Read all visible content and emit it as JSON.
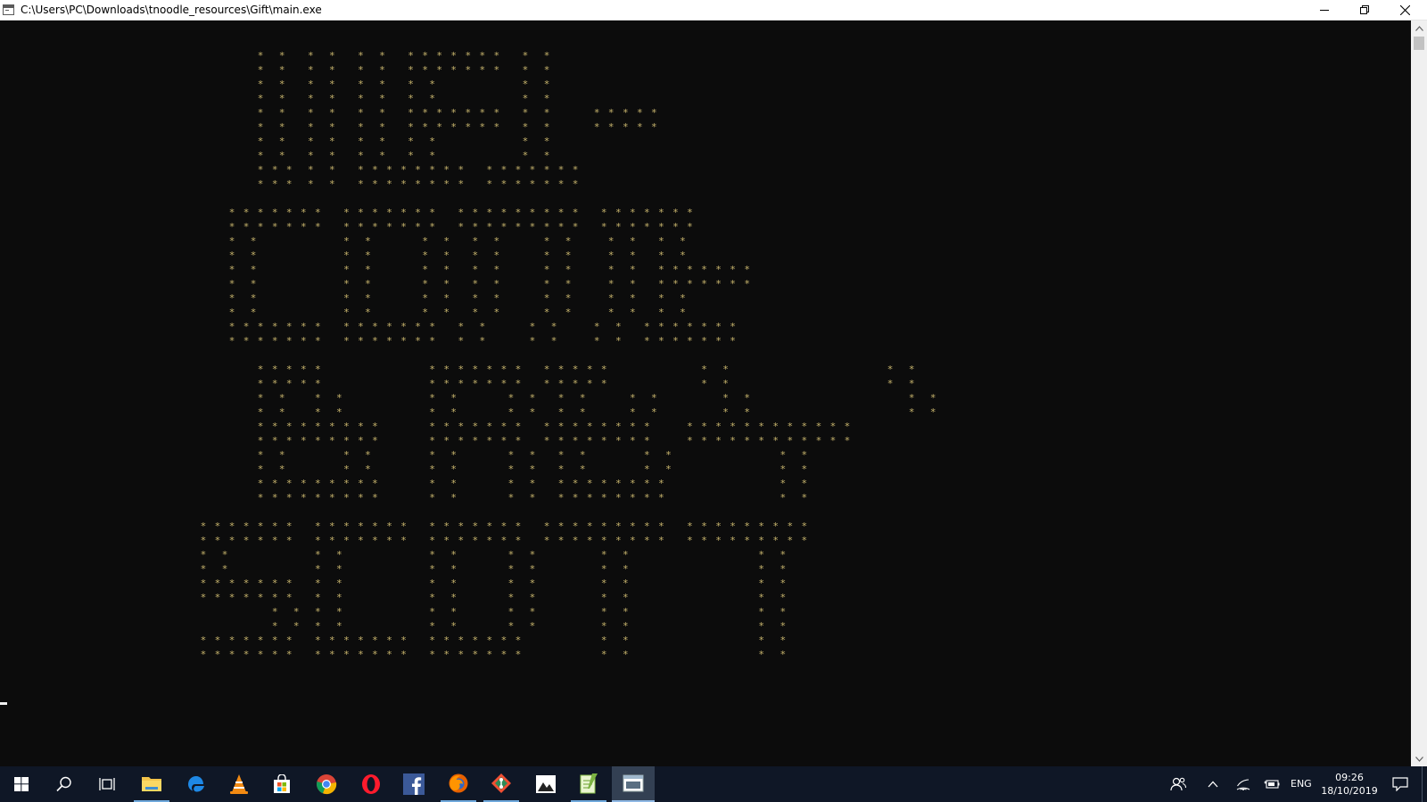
{
  "window": {
    "title": "C:\\Users\\PC\\Downloads\\tnoodle_resources\\Gift\\main.exe"
  },
  "console": {
    "banner_lines": [
      "                                ",
      "                                ",
      "                                    *  *   *  *   *  *   * * * * * * *   *  *",
      "                                    *  *   *  *   *  *   * * * * * * *   *  *",
      "                                    *  *   *  *   *  *   *  *            *  *",
      "                                    *  *   *  *   *  *   *  *            *  *",
      "                                    *  *   *  *   *  *   * * * * * * *   *  *      * * * * *",
      "                                    *  *   *  *   *  *   * * * * * * *   *  *      * * * * *",
      "                                    *  *   *  *   *  *   *  *            *  *",
      "                                    *  *   *  *   *  *   *  *            *  *",
      "                                    * * *  *  *   * * * * * * * *   * * * * * * *",
      "                                    * * *  *  *   * * * * * * * *   * * * * * * *",
      "                                ",
      "                                * * * * * * *   * * * * * * *   * * * * * * * * *   * * * * * * *",
      "                                * * * * * * *   * * * * * * *   * * * * * * * * *   * * * * * * *",
      "                                *  *            *  *       *  *   *  *      *  *     *  *   *  *",
      "                                *  *            *  *       *  *   *  *      *  *     *  *   *  *",
      "                                *  *            *  *       *  *   *  *      *  *     *  *   * * * * * * *",
      "                                *  *            *  *       *  *   *  *      *  *     *  *   * * * * * * *",
      "                                *  *            *  *       *  *   *  *      *  *     *  *   *  *",
      "                                *  *            *  *       *  *   *  *      *  *     *  *   *  *",
      "                                * * * * * * *   * * * * * * *   *  *      *  *     *  *   * * * * * * *",
      "                                * * * * * * *   * * * * * * *   *  *      *  *     *  *   * * * * * * *",
      "                                ",
      "                                    * * * * *               * * * * * * *   * * * * *             *  *                      *  *",
      "                                    * * * * *               * * * * * * *   * * * * *             *  *                      *  *",
      "                                    *  *    *  *            *  *       *  *   *  *      *  *         *  *                      *  *",
      "                                    *  *    *  *            *  *       *  *   *  *      *  *         *  *                      *  *",
      "                                    * * * * * * * * *       * * * * * * *   * * * * * * * *     * * * * * * * * * * * *",
      "                                    * * * * * * * * *       * * * * * * *   * * * * * * * *     * * * * * * * * * * * *",
      "                                    *  *        *  *        *  *       *  *   *  *        *  *               *  *",
      "                                    *  *        *  *        *  *       *  *   *  *        *  *               *  *",
      "                                    * * * * * * * * *       *  *       *  *   * * * * * * * *                *  *",
      "                                    * * * * * * * * *       *  *       *  *   * * * * * * * *                *  *",
      "                                ",
      "                            * * * * * * *   * * * * * * *   * * * * * * *   * * * * * * * * *   * * * * * * * * *",
      "                            * * * * * * *   * * * * * * *   * * * * * * *   * * * * * * * * *   * * * * * * * * *",
      "                            *  *            *  *            *  *       *  *         *  *                  *  *",
      "                            *  *            *  *            *  *       *  *         *  *                  *  *",
      "                            * * * * * * *   *  *            *  *       *  *         *  *                  *  *",
      "                            * * * * * * *   *  *            *  *       *  *         *  *                  *  *",
      "                                      *  *  *  *            *  *       *  *         *  *                  *  *",
      "                                      *  *  *  *            *  *       *  *         *  *                  *  *",
      "                            * * * * * * *   * * * * * * *   * * * * * * *           *  *                  *  *",
      "                            * * * * * * *   * * * * * * *   * * * * * * *           *  *                  *  *"
    ],
    "text_color": "#c9b66e",
    "background": "#0c0c0c"
  },
  "taskbar": {
    "apps": [
      {
        "name": "file-explorer",
        "running": true
      },
      {
        "name": "edge",
        "running": false
      },
      {
        "name": "vlc",
        "running": false
      },
      {
        "name": "store",
        "running": false
      },
      {
        "name": "chrome",
        "running": false
      },
      {
        "name": "opera",
        "running": false
      },
      {
        "name": "facebook",
        "running": false
      },
      {
        "name": "firefox",
        "running": true
      },
      {
        "name": "git",
        "running": true
      },
      {
        "name": "photos",
        "running": false
      },
      {
        "name": "notepad-plus",
        "running": true
      },
      {
        "name": "console",
        "running": true
      }
    ],
    "tray": {
      "language": "ENG",
      "time": "09:26",
      "date": "18/10/2019"
    }
  }
}
